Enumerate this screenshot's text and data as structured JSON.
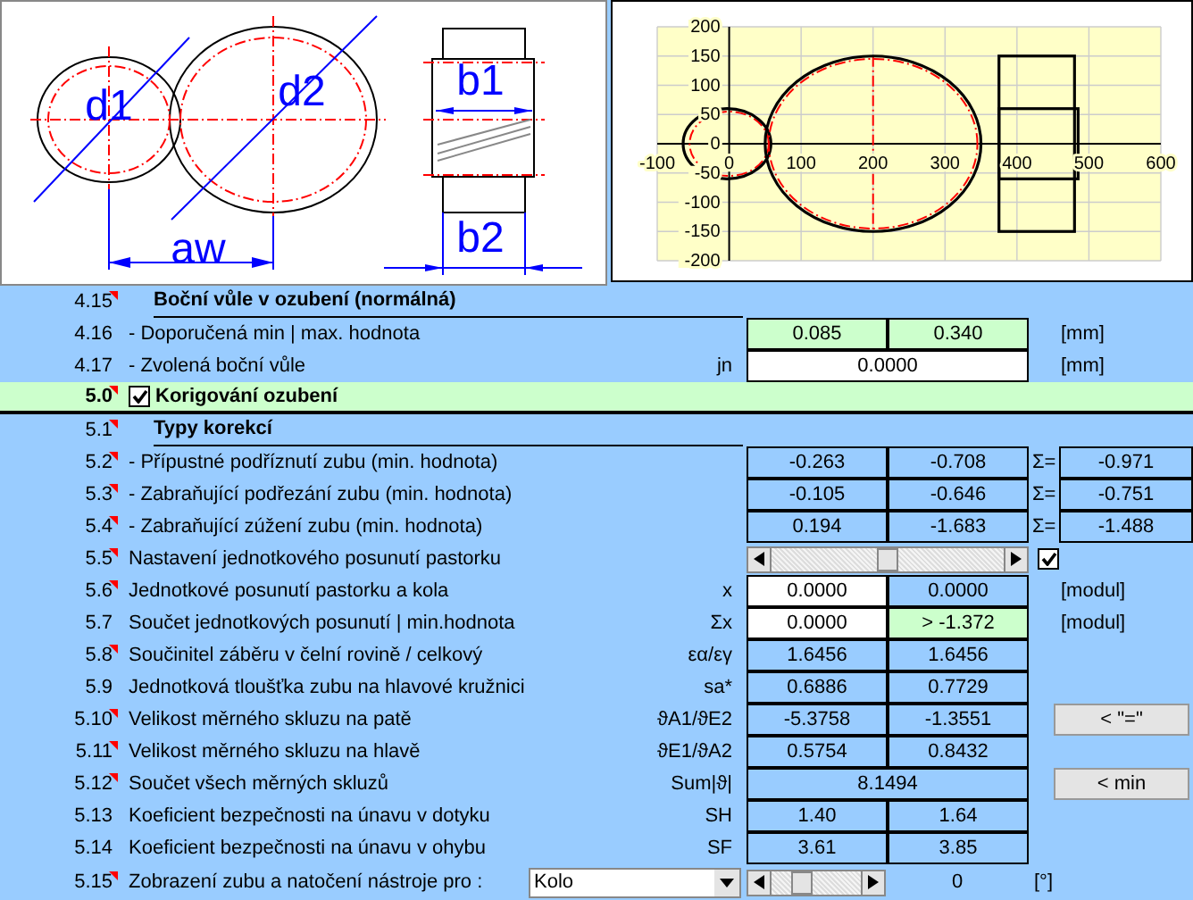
{
  "gear_drawing": {
    "labels": [
      "d1",
      "d2",
      "b1",
      "aw",
      "b2"
    ]
  },
  "chart": {
    "xticks": [
      "-100",
      "0",
      "100",
      "200",
      "300",
      "400",
      "500",
      "600"
    ],
    "yticks": [
      "200",
      "150",
      "100",
      "50",
      "0",
      "-50",
      "-100",
      "-150",
      "-200"
    ]
  },
  "rows": [
    {
      "number": "4.15",
      "note": true,
      "kind": "heading",
      "label": "Boční vůle v ozubení (normálná)"
    },
    {
      "number": "4.16",
      "note": false,
      "kind": "values",
      "label": "- Doporučená min | max. hodnota",
      "cells": [
        {
          "text": "0.085",
          "kind": "recommended"
        },
        {
          "text": "0.340",
          "kind": "recommended"
        }
      ],
      "unit": "[mm]"
    },
    {
      "number": "4.17",
      "note": false,
      "kind": "values",
      "label": "- Zvolená boční vůle",
      "symbol": "jn",
      "cells": [
        {
          "text": "0.0000",
          "kind": "input"
        }
      ],
      "unit": "[mm]"
    },
    {
      "number": "5.0",
      "note": true,
      "kind": "section",
      "checked": true,
      "label": "Korigování ozubení"
    },
    {
      "number": "5.1",
      "note": true,
      "kind": "heading",
      "label": "Typy korekcí"
    },
    {
      "number": "5.2",
      "note": true,
      "kind": "values",
      "label": "- Přípustné podříznutí zubu (min. hodnota)",
      "cells": [
        {
          "text": "-0.263",
          "kind": "computed"
        },
        {
          "text": "-0.708",
          "kind": "computed"
        }
      ],
      "sum_label": "Σ=",
      "sum": "-0.971"
    },
    {
      "number": "5.3",
      "note": true,
      "kind": "values",
      "label": "- Zabraňující podřezání zubu (min. hodnota)",
      "cells": [
        {
          "text": "-0.105",
          "kind": "computed"
        },
        {
          "text": "-0.646",
          "kind": "computed"
        }
      ],
      "sum_label": "Σ=",
      "sum": "-0.751"
    },
    {
      "number": "5.4",
      "note": true,
      "kind": "values",
      "label": "- Zabraňující zúžení zubu (min. hodnota)",
      "cells": [
        {
          "text": "0.194",
          "kind": "computed"
        },
        {
          "text": "-1.683",
          "kind": "computed"
        }
      ],
      "sum_label": "Σ=",
      "sum": "-1.488"
    },
    {
      "number": "5.5",
      "note": true,
      "kind": "slider",
      "label": "Nastavení jednotkového posunutí pastorku",
      "level": 0.5,
      "checked": true
    },
    {
      "number": "5.6",
      "note": true,
      "kind": "values",
      "label": "Jednotkové posunutí pastorku a kola",
      "symbol": "x",
      "cells": [
        {
          "text": "0.0000",
          "kind": "input"
        },
        {
          "text": "0.0000",
          "kind": "computed"
        }
      ],
      "unit": "[modul]"
    },
    {
      "number": "5.7",
      "note": false,
      "kind": "values",
      "label": "Součet jednotkových posunutí | min.hodnota",
      "symbol": "Σx",
      "cells": [
        {
          "text": "0.0000",
          "kind": "input"
        },
        {
          "text": ">  -1.372",
          "kind": "recommended"
        }
      ],
      "unit": "[modul]"
    },
    {
      "number": "5.8",
      "note": true,
      "kind": "values",
      "label": "Součinitel záběru v čelní rovině / celkový",
      "symbol": "εα/εγ",
      "cells": [
        {
          "text": "1.6456",
          "kind": "computed"
        },
        {
          "text": "1.6456",
          "kind": "computed"
        }
      ]
    },
    {
      "number": "5.9",
      "note": false,
      "kind": "values",
      "label": "Jednotková tloušťka zubu na hlavové kružnici",
      "symbol": "sa*",
      "cells": [
        {
          "text": "0.6886",
          "kind": "computed"
        },
        {
          "text": "0.7729",
          "kind": "computed"
        }
      ]
    },
    {
      "number": "5.10",
      "note": true,
      "kind": "values",
      "label": "Velikost měrného skluzu na patě",
      "symbol": "ϑA1/ϑE2",
      "cells": [
        {
          "text": "-5.3758",
          "kind": "computed"
        },
        {
          "text": "-1.3551",
          "kind": "computed"
        }
      ],
      "button": "< \"=\""
    },
    {
      "number": "5.11",
      "note": true,
      "kind": "values",
      "label": "Velikost měrného skluzu na hlavě",
      "symbol": "ϑE1/ϑA2",
      "cells": [
        {
          "text": "0.5754",
          "kind": "computed"
        },
        {
          "text": "0.8432",
          "kind": "computed"
        }
      ]
    },
    {
      "number": "5.12",
      "note": true,
      "kind": "values",
      "label": "Součet všech měrných skluzů",
      "symbol": "Sum|ϑ|",
      "cells": [
        {
          "text": "8.1494",
          "kind": "computed"
        }
      ],
      "button": "< min"
    },
    {
      "number": "5.13",
      "note": false,
      "kind": "values",
      "label": "Koeficient bezpečnosti na únavu v dotyku",
      "symbol": "SH",
      "cells": [
        {
          "text": "1.40",
          "kind": "computed"
        },
        {
          "text": "1.64",
          "kind": "computed"
        }
      ]
    },
    {
      "number": "5.14",
      "note": false,
      "kind": "values",
      "label": "Koeficient bezpečnosti na únavu v ohybu",
      "symbol": "SF",
      "cells": [
        {
          "text": "3.61",
          "kind": "computed"
        },
        {
          "text": "3.85",
          "kind": "computed"
        }
      ]
    },
    {
      "number": "5.15",
      "note": true,
      "kind": "display",
      "label": "Zobrazení zubu a natočení nástroje pro :",
      "select": "Kolo",
      "level": 0.3,
      "value": "0",
      "unit": "[°]"
    }
  ]
}
